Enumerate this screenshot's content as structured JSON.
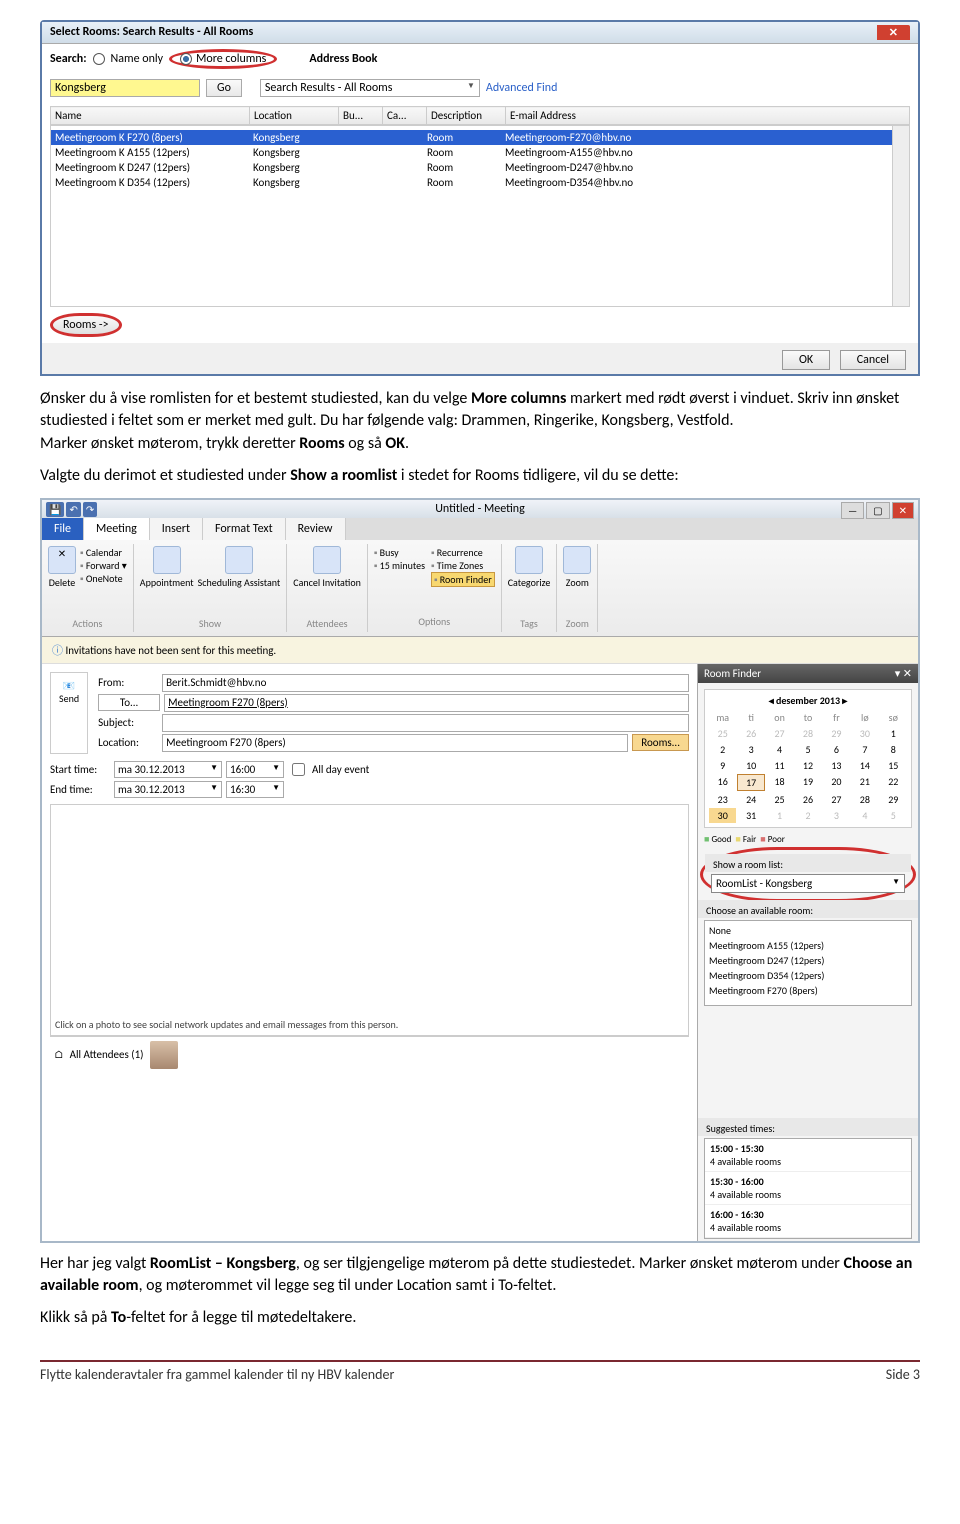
{
  "dialog1": {
    "title": "Select Rooms: Search Results - All Rooms",
    "searchLabel": "Search:",
    "nameOnly": "Name only",
    "moreCols": "More columns",
    "addrBook": "Address Book",
    "searchValue": "Kongsberg",
    "go": "Go",
    "dropdown": "Search Results - All Rooms",
    "advFind": "Advanced Find",
    "headers": [
      "Name",
      "Location",
      "Bu...",
      "Ca...",
      "Description",
      "E-mail Address"
    ],
    "rows": [
      {
        "n": "Meetingroom K F270 (8pers)",
        "l": "Kongsberg",
        "d": "Room",
        "e": "Meetingroom-F270@hbv.no",
        "sel": true
      },
      {
        "n": "Meetingroom K A155 (12pers)",
        "l": "Kongsberg",
        "d": "Room",
        "e": "Meetingroom-A155@hbv.no"
      },
      {
        "n": "Meetingroom K D247 (12pers)",
        "l": "Kongsberg",
        "d": "Room",
        "e": "Meetingroom-D247@hbv.no"
      },
      {
        "n": "Meetingroom K D354 (12pers)",
        "l": "Kongsberg",
        "d": "Room",
        "e": "Meetingroom-D354@hbv.no"
      }
    ],
    "roomsBtn": "Rooms ->",
    "ok": "OK",
    "cancel": "Cancel"
  },
  "para1_a": "Ønsker du å vise romlisten for et bestemt studiested, kan du velge ",
  "para1_b": "More columns",
  "para1_c": " markert med rødt øverst i vinduet. Skriv inn ønsket studiested i feltet som er merket med gult. Du har følgende valg: Drammen, Ringerike, Kongsberg, Vestfold.",
  "para1_d": "Marker ønsket møterom, trykk deretter ",
  "para1_e": "Rooms",
  "para1_f": " og så ",
  "para1_g": "OK",
  "para1_h": ".",
  "para2_a": "Valgte du derimot et studiested under ",
  "para2_b": "Show a roomlist",
  "para2_c": " i stedet for Rooms tidligere, vil du se dette:",
  "outlook": {
    "title": "Untitled - Meeting",
    "tabs": [
      "File",
      "Meeting",
      "Insert",
      "Format Text",
      "Review"
    ],
    "r": {
      "actions": {
        "lbl": "Actions",
        "a": "Calendar",
        "b": "Forward ▾",
        "c": "OneNote",
        "del": "Delete"
      },
      "show": {
        "lbl": "Show",
        "a": "Appointment",
        "b": "Scheduling Assistant"
      },
      "attendees": {
        "lbl": "Attendees",
        "a": "Cancel Invitation"
      },
      "options": {
        "lbl": "Options",
        "busy": "Busy",
        "min": "15 minutes",
        "rec": "Recurrence",
        "tz": "Time Zones",
        "rf": "Room Finder"
      },
      "tags": {
        "lbl": "Tags",
        "a": "Categorize"
      },
      "zoom": {
        "lbl": "Zoom",
        "a": "Zoom"
      }
    },
    "notify": "Invitations have not been sent for this meeting.",
    "from": "From:",
    "fromVal": "Berit.Schmidt@hbv.no",
    "to": "To...",
    "toVal": "Meetingroom F270 (8pers)",
    "subject": "Subject:",
    "location": "Location:",
    "locVal": "Meetingroom F270 (8pers)",
    "roomsBtn": "Rooms...",
    "send": "Send",
    "start": "Start time:",
    "end": "End time:",
    "date": "ma 30.12.2013",
    "t1": "16:00",
    "t2": "16:30",
    "allDay": "All day event",
    "social": "Click on a photo to see social network updates and email messages from this person.",
    "allAtt": "All Attendees (1)",
    "rf": {
      "title": "Room Finder",
      "month": "desember 2013",
      "days": [
        "ma",
        "ti",
        "on",
        "to",
        "fr",
        "lø",
        "sø"
      ],
      "good": "Good",
      "fair": "Fair",
      "poor": "Poor",
      "showList": "Show a room list:",
      "listVal": "RoomList - Kongsberg",
      "choose": "Choose an available room:",
      "rooms": [
        "None",
        "Meetingroom A155 (12pers)",
        "Meetingroom D247 (12pers)",
        "Meetingroom D354 (12pers)",
        "Meetingroom F270 (8pers)"
      ],
      "sugg": "Suggested times:",
      "slots": [
        {
          "t": "15:00 - 15:30",
          "a": "4 available rooms"
        },
        {
          "t": "15:30 - 16:00",
          "a": "4 available rooms"
        },
        {
          "t": "16:00 - 16:30",
          "a": "4 available rooms"
        }
      ]
    }
  },
  "para3_a": "Her har jeg valgt ",
  "para3_b": "RoomList – Kongsberg",
  "para3_c": ", og ser tilgjengelige møterom på dette studiestedet. Marker ønsket møterom under ",
  "para3_d": "Choose an available room",
  "para3_e": ", og møterommet vil legge seg til under Location samt i To-feltet.",
  "para4_a": "Klikk så på ",
  "para4_b": "To",
  "para4_c": "-feltet for å legge til møtedeltakere.",
  "footer": {
    "l": "Flytte kalenderavtaler fra gammel kalender til ny HBV kalender",
    "r": "Side 3"
  }
}
